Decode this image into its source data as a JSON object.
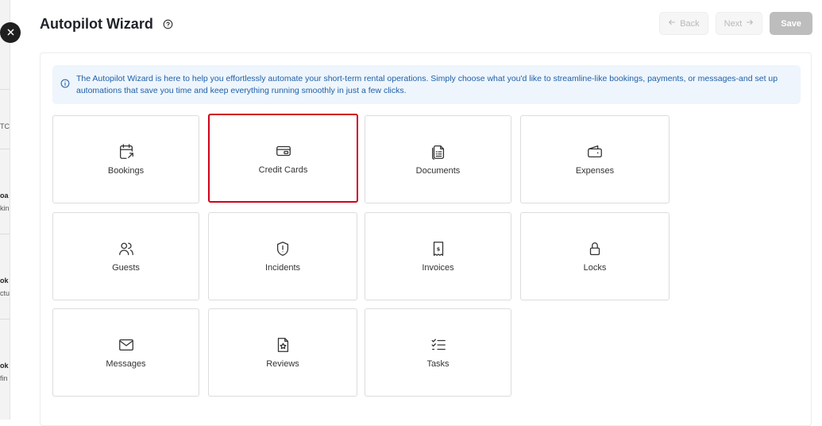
{
  "page": {
    "title": "Autopilot Wizard"
  },
  "header_actions": {
    "back_label": "Back",
    "next_label": "Next",
    "save_label": "Save"
  },
  "info_banner": {
    "text": "The Autopilot Wizard is here to help you effortlessly automate your short-term rental operations. Simply choose what you'd like to streamline-like bookings, payments, or messages-and set up automations that save you time and keep everything running smoothly in just a few clicks."
  },
  "categories": [
    {
      "label": "Bookings",
      "icon": "calendar-arrow-icon"
    },
    {
      "label": "Credit Cards",
      "icon": "credit-card-icon",
      "selected": true
    },
    {
      "label": "Documents",
      "icon": "documents-icon"
    },
    {
      "label": "Expenses",
      "icon": "wallet-icon"
    },
    {
      "label": "Guests",
      "icon": "users-icon"
    },
    {
      "label": "Incidents",
      "icon": "shield-alert-icon"
    },
    {
      "label": "Invoices",
      "icon": "invoice-icon"
    },
    {
      "label": "Locks",
      "icon": "lock-icon"
    },
    {
      "label": "Messages",
      "icon": "mail-icon"
    },
    {
      "label": "Reviews",
      "icon": "review-star-icon"
    },
    {
      "label": "Tasks",
      "icon": "task-list-icon"
    }
  ],
  "backdrop_fragments": [
    "TC",
    "oa",
    "kin",
    "ok",
    "ctu",
    "ok",
    "fin"
  ],
  "colors": {
    "selection_outline": "#d0021b",
    "info_background": "#eef5fc",
    "info_text": "#2061a8",
    "save_disabled": "#bdbdbd"
  }
}
